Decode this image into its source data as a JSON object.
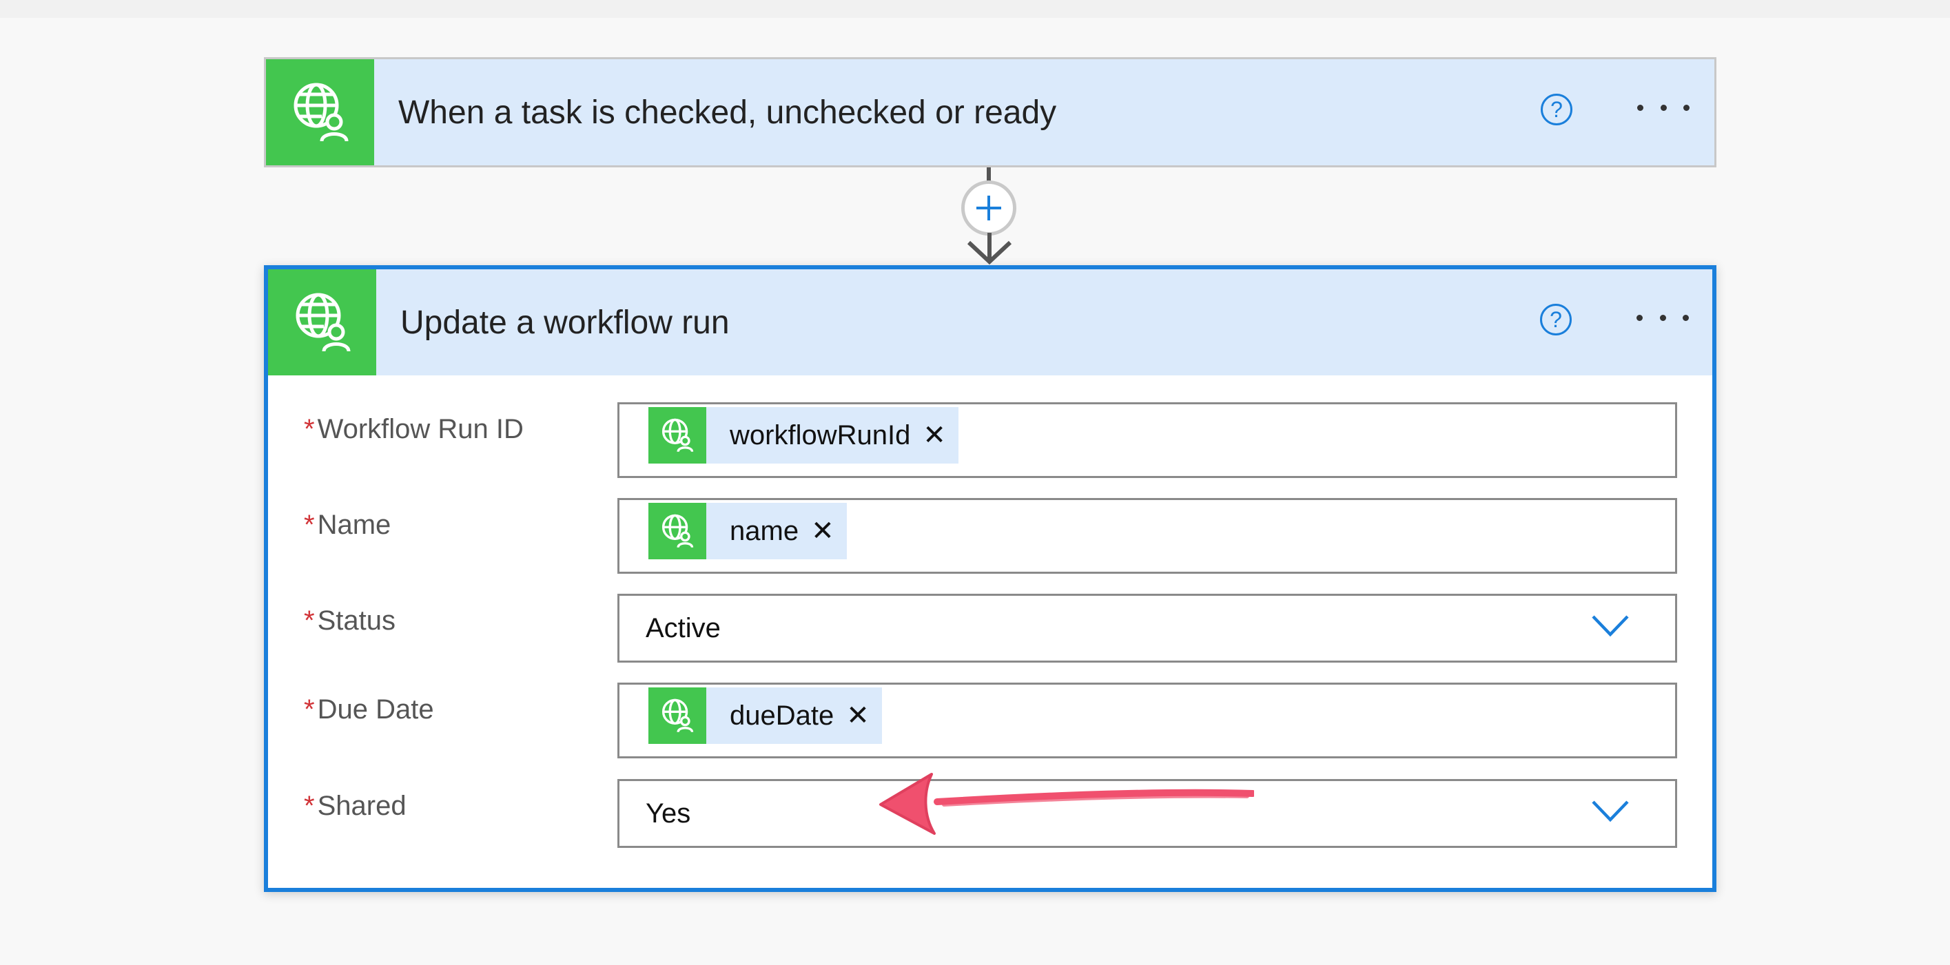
{
  "trigger": {
    "title": "When a task is checked, unchecked or ready",
    "icon": "globe-person-icon"
  },
  "action": {
    "title": "Update a workflow run",
    "icon": "globe-person-icon",
    "fields": {
      "workflow_run_id": {
        "label": "Workflow Run ID",
        "required": "*",
        "token": "workflowRunId"
      },
      "name": {
        "label": "Name",
        "required": "*",
        "token": "name"
      },
      "status": {
        "label": "Status",
        "required": "*",
        "value": "Active"
      },
      "due_date": {
        "label": "Due Date",
        "required": "*",
        "token": "dueDate"
      },
      "shared": {
        "label": "Shared",
        "required": "*",
        "value": "Yes"
      }
    }
  },
  "icons": {
    "help": "?",
    "remove": "✕"
  },
  "colors": {
    "accent": "#1a7fdb",
    "connector_green": "#43c64f",
    "header_bg": "#dbeafb",
    "required": "#d13438",
    "annotation": "#f0506e"
  }
}
